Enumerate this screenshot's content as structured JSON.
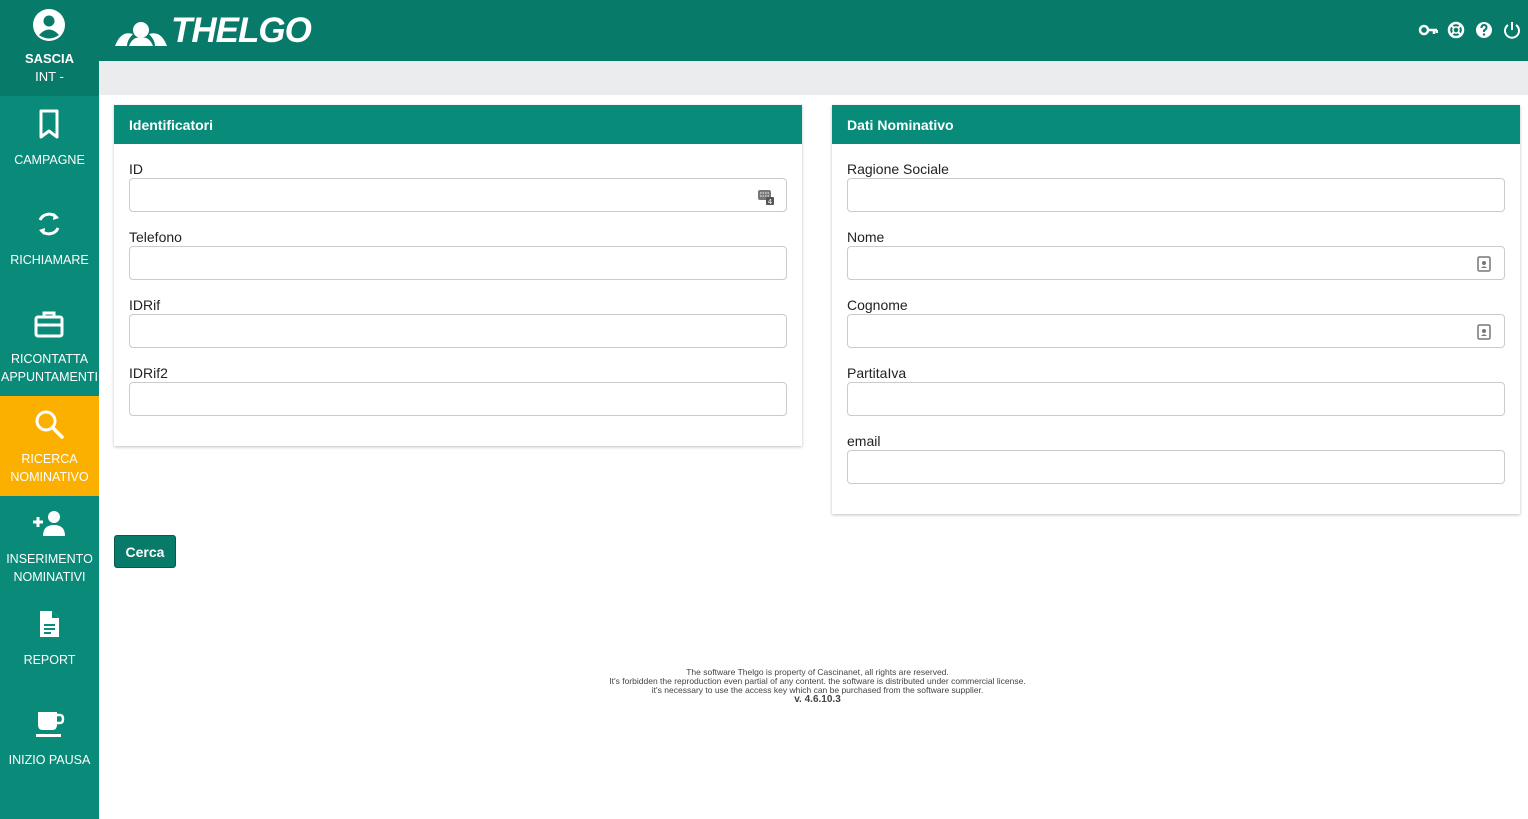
{
  "user": {
    "name": "SASCIA",
    "role": "INT -"
  },
  "logo": {
    "text": "THELGO"
  },
  "sidebar": {
    "items": [
      {
        "label_1": "CAMPAGNE",
        "label_2": "",
        "icon": "bookmark-icon"
      },
      {
        "label_1": "RICHIAMARE",
        "label_2": "",
        "icon": "refresh-icon"
      },
      {
        "label_1": "RICONTATTA",
        "label_2": "APPUNTAMENTI",
        "icon": "briefcase-icon"
      },
      {
        "label_1": "RICERCA",
        "label_2": "NOMINATIVO",
        "icon": "search-icon"
      },
      {
        "label_1": "INSERIMENTO",
        "label_2": "NOMINATIVI",
        "icon": "add-user-icon"
      },
      {
        "label_1": "REPORT",
        "label_2": "",
        "icon": "document-icon"
      },
      {
        "label_1": "INIZIO PAUSA",
        "label_2": "",
        "icon": "coffee-icon"
      }
    ],
    "active_index": 3,
    "colors": {
      "background": "#0a8a78",
      "active": "#fbb000"
    }
  },
  "header": {
    "icons": [
      "key-icon",
      "lifebuoy-icon",
      "help-icon",
      "power-icon"
    ],
    "color": "#077a69"
  },
  "panels": {
    "identificatori": {
      "title": "Identificatori",
      "fields": [
        {
          "label": "ID",
          "value": ""
        },
        {
          "label": "Telefono",
          "value": ""
        },
        {
          "label": "IDRif",
          "value": ""
        },
        {
          "label": "IDRif2",
          "value": ""
        }
      ]
    },
    "dati_nominativo": {
      "title": "Dati Nominativo",
      "fields": [
        {
          "label": "Ragione Sociale",
          "value": ""
        },
        {
          "label": "Nome",
          "value": ""
        },
        {
          "label": "Cognome",
          "value": ""
        },
        {
          "label": "PartitaIva",
          "value": ""
        },
        {
          "label": "email",
          "value": ""
        }
      ]
    }
  },
  "actions": {
    "search_label": "Cerca"
  },
  "footer": {
    "line1": "The software Thelgo is property of Cascinanet, all rights are reserved.",
    "line2": "It's forbidden the reproduction even partial of any content. the software is distributed under commercial license.",
    "line3": "it's necessary to use the access key which can be purchased from the software supplier.",
    "version": "v. 4.6.10.3"
  }
}
